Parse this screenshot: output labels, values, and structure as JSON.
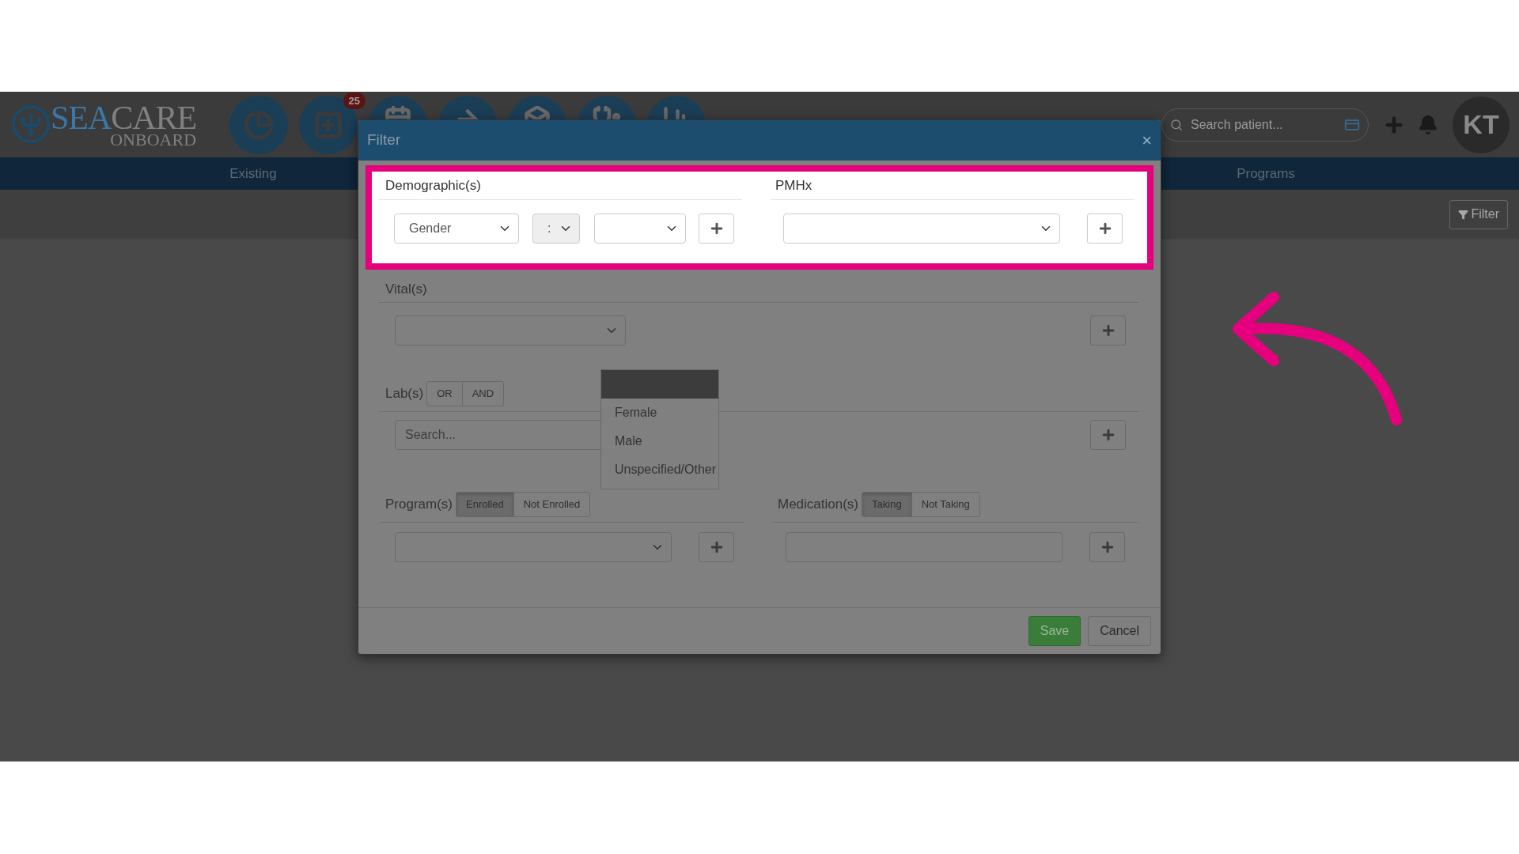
{
  "brand": {
    "first": "SEA",
    "second": "CARE",
    "subtitle": "ONBOARD"
  },
  "header": {
    "notification_badge": "25",
    "search": {
      "placeholder": "Search patient..."
    },
    "avatar": "KT"
  },
  "nav_tabs": [
    {
      "label": "Existing"
    },
    {
      "label": "Programs"
    }
  ],
  "filter_button": "Filter",
  "modal": {
    "title": "Filter",
    "close": "×",
    "demographics": {
      "label": "Demographic(s)",
      "field": "Gender",
      "operator": ":"
    },
    "pmhx": {
      "label": "PMHx"
    },
    "vitals": {
      "label": "Vital(s)"
    },
    "labs": {
      "label": "Lab(s)",
      "toggles": [
        {
          "label": "OR",
          "selected": false
        },
        {
          "label": "AND",
          "selected": false
        }
      ],
      "search": {
        "placeholder": "Search..."
      }
    },
    "programs": {
      "label": "Program(s)",
      "toggles": [
        {
          "label": "Enrolled",
          "selected": true
        },
        {
          "label": "Not Enrolled",
          "selected": false
        }
      ]
    },
    "medications": {
      "label": "Medication(s)",
      "toggles": [
        {
          "label": "Taking",
          "selected": true
        },
        {
          "label": "Not Taking",
          "selected": false
        }
      ]
    },
    "buttons": [
      {
        "label": "Save",
        "kind": "primary"
      },
      {
        "label": "Cancel",
        "kind": "default"
      }
    ],
    "dropdown_options": [
      {
        "label": "Female"
      },
      {
        "label": "Male"
      },
      {
        "label": "Unspecified/Other"
      }
    ]
  }
}
